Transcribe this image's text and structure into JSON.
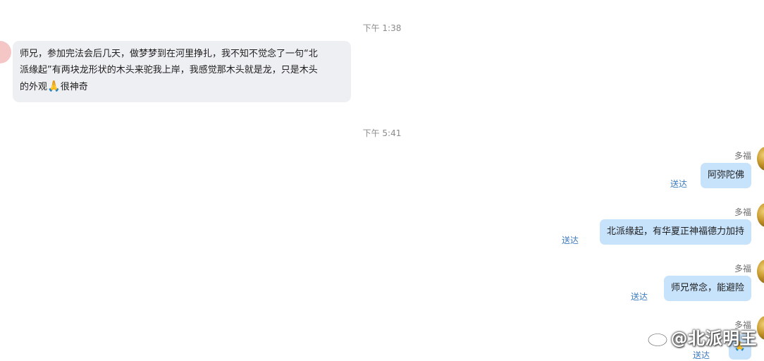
{
  "chat": {
    "timestamp_1": "下午 1:38",
    "incoming_message": {
      "line1": "师兄，参加完法会后几天，做梦梦到在河里挣扎，我不知不觉念了一句“北",
      "line2": "派缘起”有两块龙形状的木头来驼我上岸，我感觉那木头就是龙，只是木头",
      "line3_before_emoji": "的外观",
      "emoji": "🙏",
      "line3_after_emoji": "很神奇"
    },
    "timestamp_2": "下午 5:41",
    "outgoing_messages": [
      {
        "sender": "多福",
        "text": "阿弥陀佛",
        "status": "送达"
      },
      {
        "sender": "多福",
        "text": "北派缘起，有华夏正神福德力加持",
        "status": "送达"
      },
      {
        "sender": "多福",
        "text": "师兄常念，能避险",
        "status": "送达"
      },
      {
        "sender": "多福",
        "text": "🙏",
        "status": "送达"
      }
    ]
  },
  "watermark": {
    "text": "@北派明王",
    "icon": "weibo-logo-icon"
  }
}
